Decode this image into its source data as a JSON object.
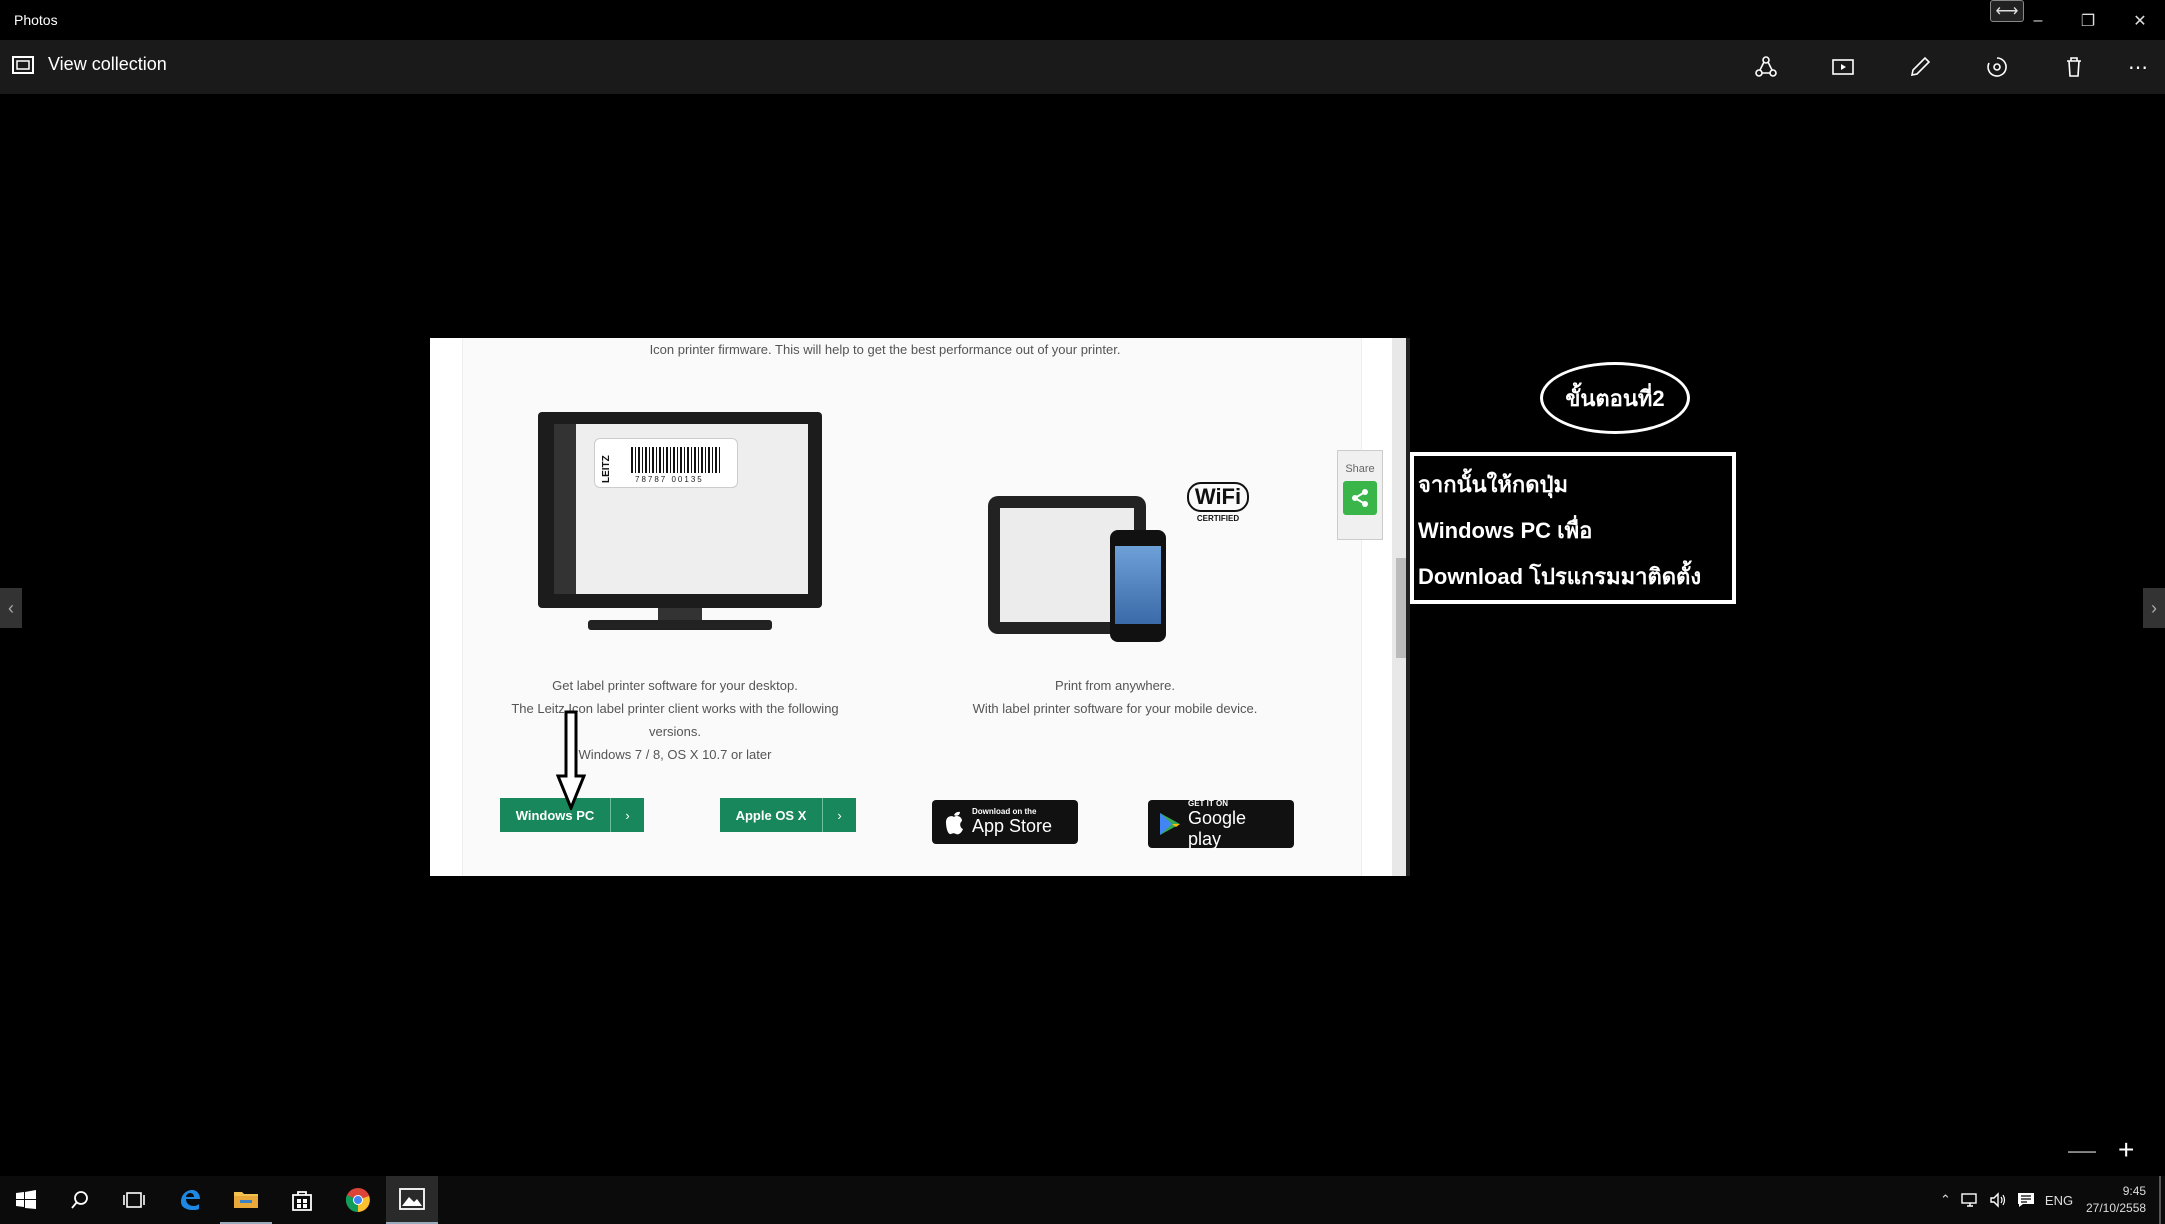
{
  "window": {
    "title": "Photos"
  },
  "toolbar": {
    "view_collection": "View collection",
    "icons": [
      "share-icon",
      "slideshow-icon",
      "edit-icon",
      "rotate-icon",
      "delete-icon",
      "more-icon"
    ]
  },
  "photo": {
    "top_text": "Icon printer firmware. This will help to get the best performance out of your printer.",
    "barcode_number": "78787 00135",
    "leitz": "LEITZ",
    "desktop_desc": [
      "Get label printer software for your desktop.",
      "The Leitz Icon label printer client works with the following",
      "versions.",
      "Windows 7 / 8, OS X 10.7 or later"
    ],
    "mobile_desc": [
      "Print from anywhere.",
      "With label printer software for your mobile device."
    ],
    "wifi_logo": "WiFi",
    "wifi_certified": "CERTIFIED",
    "share_label": "Share",
    "btn_windows": "Windows PC",
    "btn_apple": "Apple OS X",
    "appstore_small": "Download on the",
    "appstore_big": "App Store",
    "googleplay_small": "GET IT ON",
    "googleplay_big": "Google play"
  },
  "annotation": {
    "step": "ขั้นตอนที่2",
    "line1": "จากนั้นให้กดปุ่ม",
    "line2": "Windows PC เพื่อ",
    "line3": "Download โปรแกรมมาติดตั้ง"
  },
  "zoom": {
    "minus": "—",
    "plus": "+"
  },
  "taskbar": {
    "lang": "ENG",
    "time": "9:45",
    "date": "27/10/2558"
  }
}
